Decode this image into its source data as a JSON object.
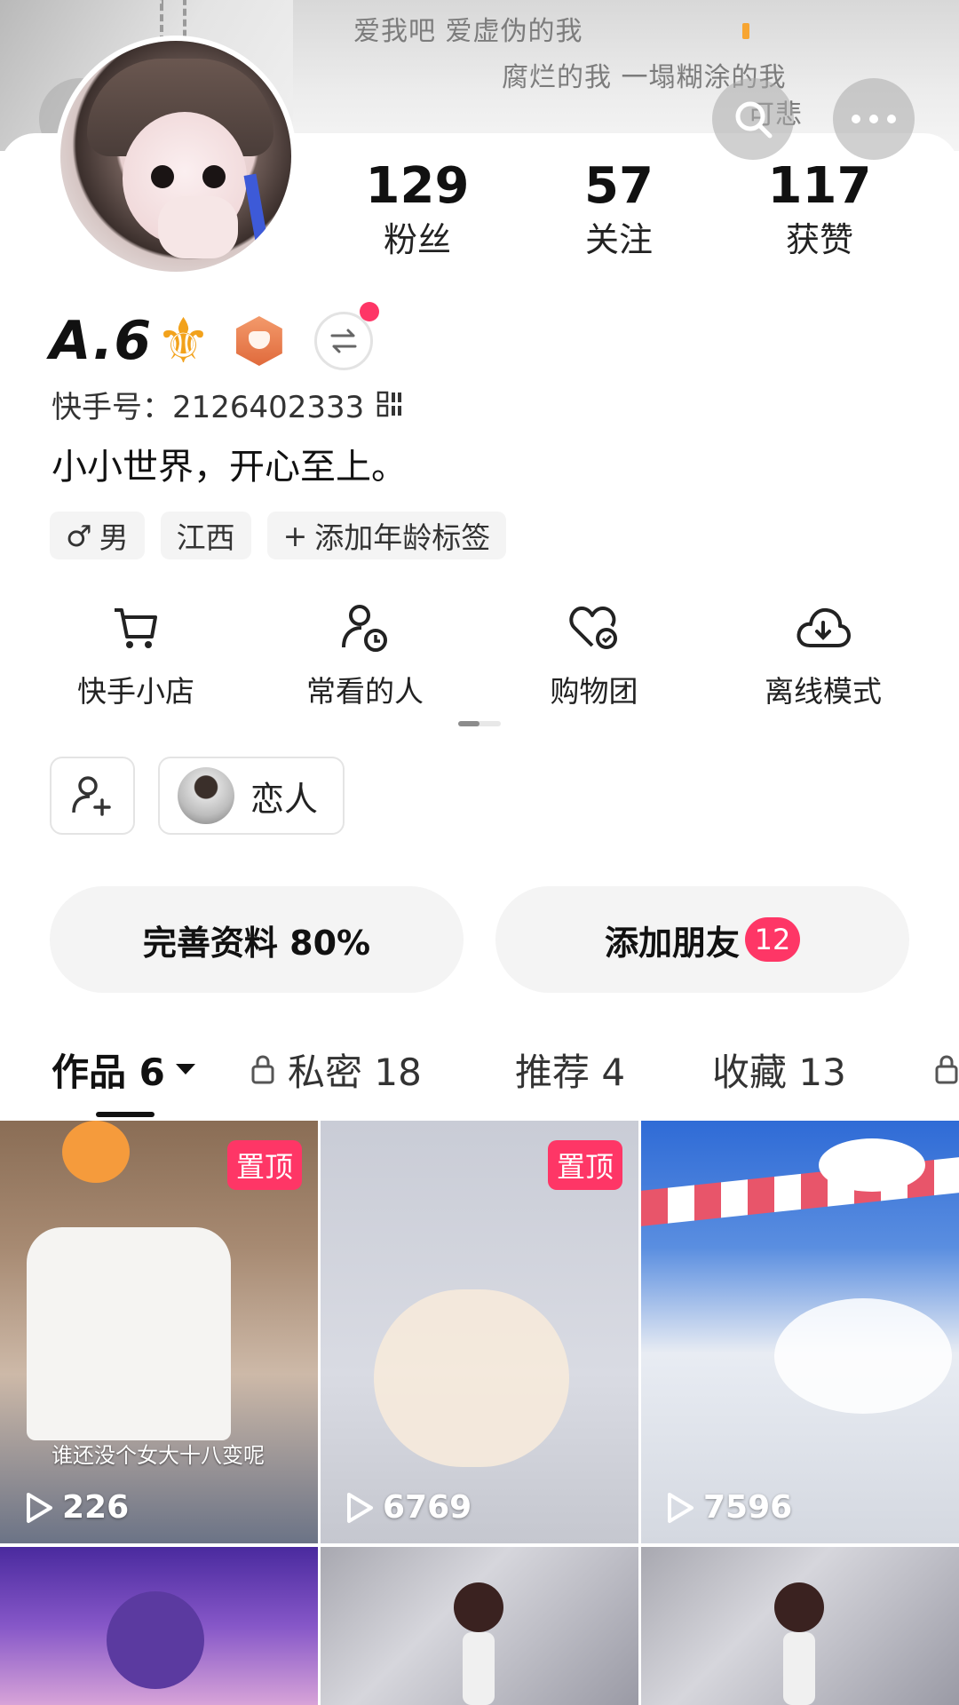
{
  "banner": {
    "line1": "爱我吧 爱虚伪的我",
    "line2": "腐烂的我 一塌糊涂的我",
    "line3": "可悲"
  },
  "nav": {
    "back_icon": "chevron-left-icon",
    "search_icon": "search-icon",
    "more_icon": "more-horizontal-icon"
  },
  "stats": [
    {
      "value": "129",
      "label": "粉丝"
    },
    {
      "value": "57",
      "label": "关注"
    },
    {
      "value": "117",
      "label": "获赞"
    }
  ],
  "profile": {
    "name": "A.6",
    "name_symbol": "⚜",
    "uid_label": "快手号：2126402333",
    "bio": "小小世界，开心至上。"
  },
  "tags": [
    {
      "icon": "male-icon",
      "symbol": "♂",
      "label": "男"
    },
    {
      "label": "江西"
    },
    {
      "symbol": "+",
      "label": "添加年龄标签"
    }
  ],
  "tools": [
    {
      "icon": "cart-icon",
      "label": "快手小店"
    },
    {
      "icon": "user-clock-icon",
      "label": "常看的人"
    },
    {
      "icon": "heart-plus-icon",
      "label": "购物团"
    },
    {
      "icon": "cloud-download-icon",
      "label": "离线模式"
    }
  ],
  "relation": {
    "lover_label": "恋人"
  },
  "actions": {
    "complete_profile": "完善资料 80%",
    "add_friends": "添加朋友",
    "add_friends_badge": "12"
  },
  "tabs": [
    {
      "label": "作品 6",
      "active": true
    },
    {
      "label": "私密 18"
    },
    {
      "label": "推荐 4"
    },
    {
      "label": "收藏 13"
    }
  ],
  "videos": [
    {
      "pinned": "置顶",
      "plays": "226",
      "caption": "谁还没个女大十八变呢"
    },
    {
      "pinned": "置顶",
      "plays": "6769"
    },
    {
      "plays": "7596"
    }
  ],
  "colors": {
    "accent": "#fe3666",
    "medal": "#f39a6b",
    "fleur": "#f2a21c"
  }
}
